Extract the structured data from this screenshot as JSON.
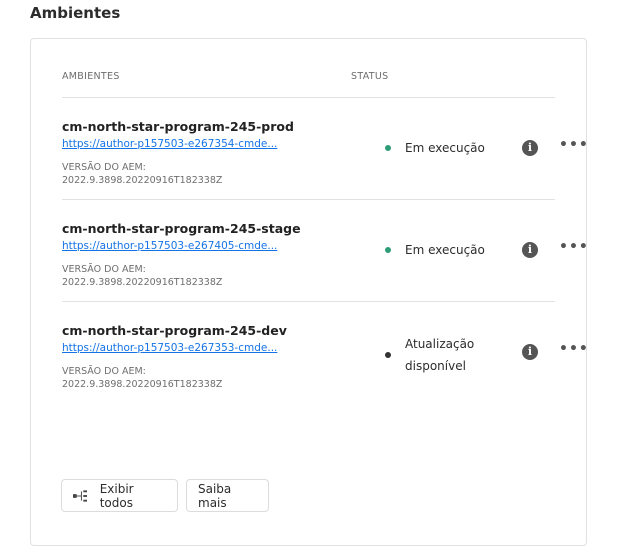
{
  "section_title": "Ambientes",
  "table": {
    "headers": {
      "environments": "AMBIENTES",
      "status": "STATUS"
    },
    "rows": [
      {
        "name": "cm-north-star-program-245-prod",
        "url": "https://author-p157503-e267354-cmde...",
        "version_label": "VERSÃO DO AEM:",
        "version": "2022.9.3898.20220916T182338Z",
        "status": "Em execução",
        "status_color": "#2d9d78"
      },
      {
        "name": "cm-north-star-program-245-stage",
        "url": "https://author-p157503-e267405-cmde...",
        "version_label": "VERSÃO DO AEM:",
        "version": "2022.9.3898.20220916T182338Z",
        "status": "Em execução",
        "status_color": "#2d9d78"
      },
      {
        "name": "cm-north-star-program-245-dev",
        "url": "https://author-p157503-e267353-cmde...",
        "version_label": "VERSÃO DO AEM:",
        "version": "2022.9.3898.20220916T182338Z",
        "status": "Atualização disponível",
        "status_color": "#333333"
      }
    ],
    "icons": {
      "info": "info-icon",
      "more": "more-icon"
    }
  },
  "buttons": {
    "show_all": "Exibir todos",
    "learn_more": "Saiba mais",
    "show_all_icon": "tree-view-icon"
  }
}
